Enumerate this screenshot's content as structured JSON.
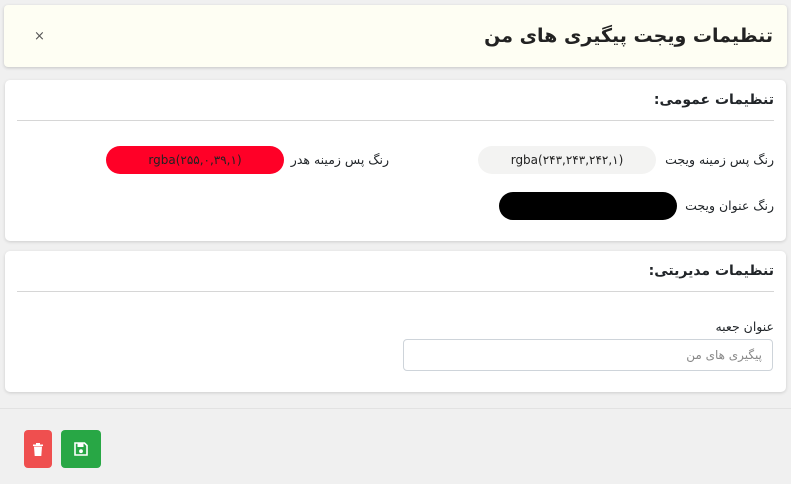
{
  "header": {
    "title": "تنظیمات ویجت پیگیری های من",
    "close_label": "×"
  },
  "general": {
    "title": "تنظیمات عمومی:",
    "widget_bg": {
      "label": "رنگ پس زمینه ویجت",
      "value": "rgba(۲۴۳,۲۴۳,۲۴۲,۱)",
      "color": "#f3f3f2"
    },
    "header_bg": {
      "label": "رنگ پس زمینه هدر",
      "value": "rgba(۲۵۵,۰,۳۹,۱)",
      "color": "#ff0027"
    },
    "title_color": {
      "label": "رنگ عنوان ویجت",
      "value": "",
      "color": "#000000"
    }
  },
  "admin": {
    "title": "تنظیمات مدیریتی:",
    "box_title_label": "عنوان جعبه",
    "box_title_placeholder": "پیگیری های من"
  },
  "actions": {
    "delete_icon": "trash-icon",
    "save_icon": "floppy-disk-icon",
    "delete_color": "#ef4f4f",
    "save_color": "#28a745"
  }
}
